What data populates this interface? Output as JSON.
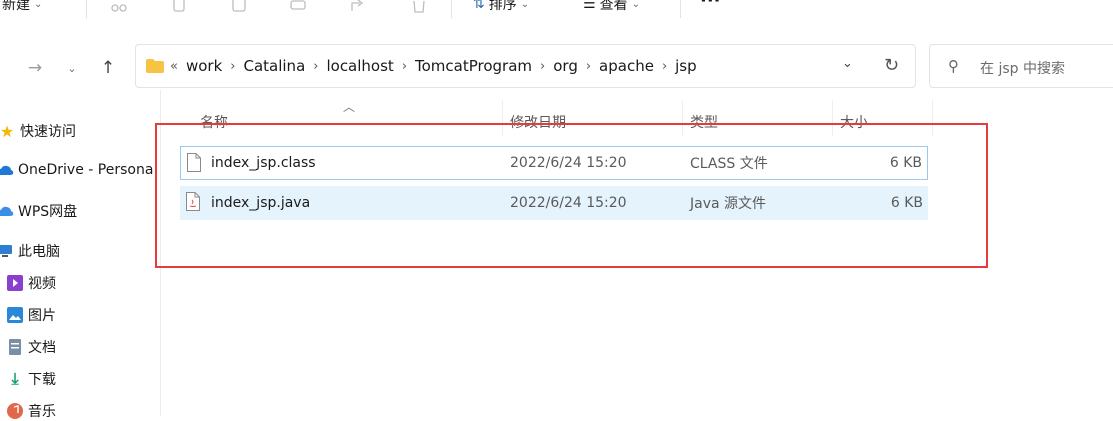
{
  "toolbar": {
    "new_label": "新建",
    "sort_label": "排序",
    "view_label": "查看",
    "more_label": "···"
  },
  "address": {
    "overflow_marker": "«",
    "breadcrumbs": [
      "work",
      "Catalina",
      "localhost",
      "TomcatProgram",
      "org",
      "apache",
      "jsp"
    ]
  },
  "search": {
    "placeholder": "在 jsp 中搜索"
  },
  "sidebar": {
    "items": [
      {
        "label": "快速访问",
        "icon": "star-icon"
      },
      {
        "label": "OneDrive - Persona",
        "icon": "cloud-icon"
      },
      {
        "label": "WPS网盘",
        "icon": "cloud-icon"
      },
      {
        "label": "此电脑",
        "icon": "computer-icon"
      },
      {
        "label": "视频",
        "icon": "video-icon"
      },
      {
        "label": "图片",
        "icon": "picture-icon"
      },
      {
        "label": "文档",
        "icon": "document-icon"
      },
      {
        "label": "下载",
        "icon": "download-icon"
      },
      {
        "label": "音乐",
        "icon": "music-icon"
      }
    ]
  },
  "columns": {
    "name": "名称",
    "date": "修改日期",
    "type": "类型",
    "size": "大小"
  },
  "files": [
    {
      "name": "index_jsp.class",
      "date": "2022/6/24 15:20",
      "type": "CLASS 文件",
      "size": "6 KB",
      "icon": "file-icon"
    },
    {
      "name": "index_jsp.java",
      "date": "2022/6/24 15:20",
      "type": "Java 源文件",
      "size": "6 KB",
      "icon": "java-file-icon"
    }
  ],
  "colors": {
    "highlight_border": "#e53b3b",
    "selected_row": "#e5f3fd",
    "hover_border": "#99c9ef"
  }
}
